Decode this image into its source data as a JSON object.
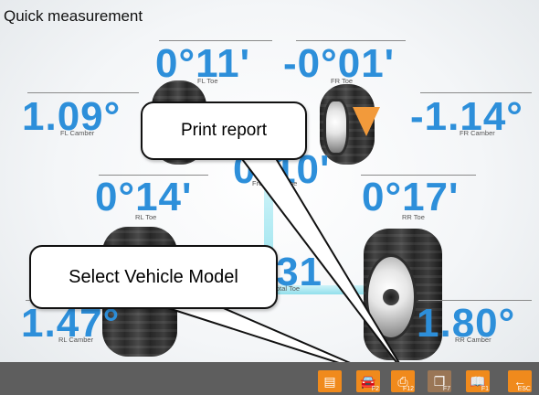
{
  "header": {
    "title": "Quick measurement"
  },
  "readings": {
    "fl_toe": {
      "value": "0°11'",
      "label": "FL Toe"
    },
    "fr_toe": {
      "value": "-0°01'",
      "label": "FR Toe"
    },
    "fl_camber": {
      "value": "1.09°",
      "label": "FL Camber"
    },
    "fr_camber": {
      "value": "-1.14°",
      "label": "FR Camber"
    },
    "front_total_toe": {
      "value": "0°10'",
      "label": "Front Total Toe"
    },
    "rl_toe": {
      "value": "0°14'",
      "label": "RL Toe"
    },
    "rr_toe": {
      "value": "0°17'",
      "label": "RR Toe"
    },
    "rear_total_toe": {
      "value": "0°31'",
      "label": "Rear Total Toe"
    },
    "rl_camber": {
      "value": "1.47°",
      "label": "RL Camber"
    },
    "rr_camber": {
      "value": "1.80°",
      "label": "RR Camber"
    }
  },
  "callouts": {
    "print_report": "Print report",
    "select_vehicle": "Select Vehicle Model"
  },
  "toolbar": {
    "buttons": [
      {
        "icon": "report-icon",
        "key": ""
      },
      {
        "icon": "car-icon",
        "key": "F2"
      },
      {
        "icon": "printer-icon",
        "key": "F12"
      },
      {
        "icon": "copy-icon",
        "key": "F7"
      },
      {
        "icon": "help-book-icon",
        "key": "F1"
      },
      {
        "icon": "back-arrow-icon",
        "key": "ESC"
      }
    ]
  },
  "colors": {
    "value_blue": "#2d8fda",
    "toolbar": "#5e5e5e",
    "button_orange": "#f08a1c"
  }
}
